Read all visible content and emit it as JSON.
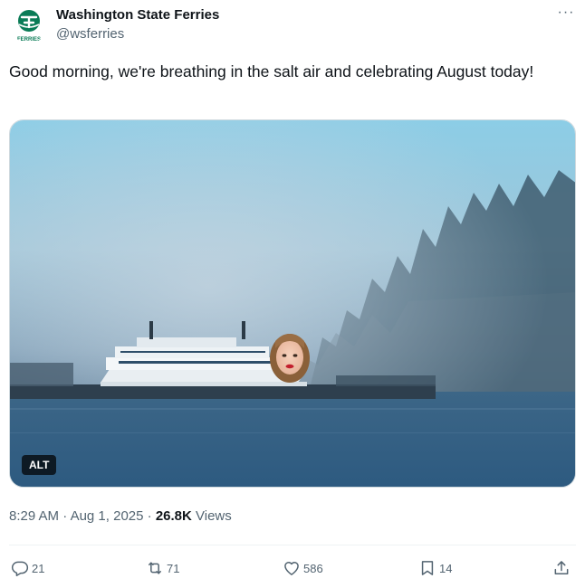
{
  "author": {
    "display_name": "Washington State Ferries",
    "handle": "@wsferries",
    "logo_text": "FERRIES",
    "brand_color": "#0a7b56"
  },
  "menu": {
    "more_label": "···"
  },
  "tweet": {
    "text": "Good morning, we're breathing in the salt air and celebrating August today!"
  },
  "media": {
    "alt_label": "ALT",
    "description_icon": "image-photo"
  },
  "meta": {
    "time": "8:29 AM",
    "separator1": " · ",
    "date": "Aug 1, 2025",
    "separator2": " · ",
    "views_count": "26.8K",
    "views_label": " Views"
  },
  "actions": {
    "replies": "21",
    "reposts": "71",
    "likes": "586",
    "bookmarks": "14"
  },
  "colors": {
    "text_primary": "#0f1419",
    "text_secondary": "#536471",
    "divider": "#eff3f4"
  }
}
